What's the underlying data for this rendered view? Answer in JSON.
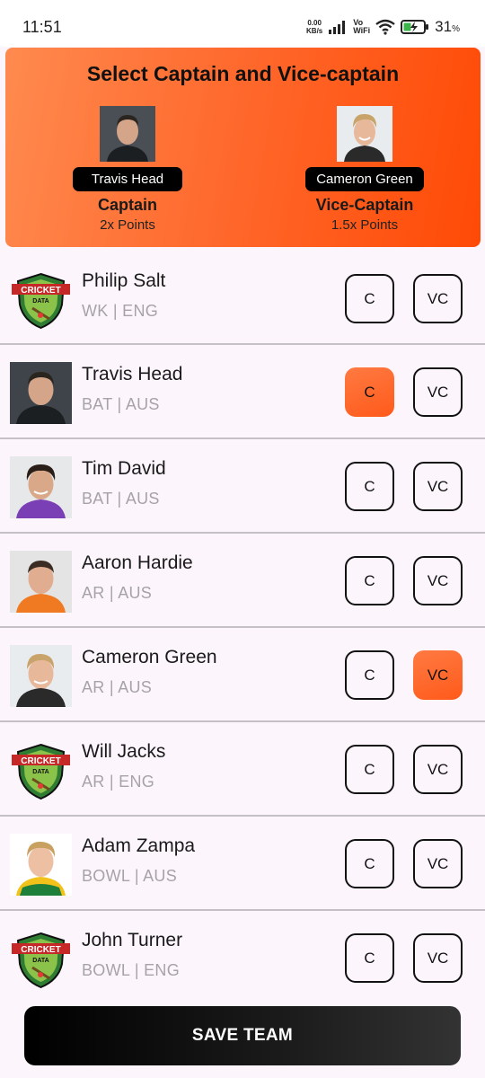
{
  "status_bar": {
    "time": "11:51",
    "speed_value": "0.00",
    "speed_unit": "KB/s",
    "volte_top": "Vo",
    "volte_bottom": "WiFi",
    "battery_percent": "31",
    "battery_unit": "%",
    "icons": [
      "signal-bars-icon",
      "wifi-icon",
      "battery-charging-icon"
    ]
  },
  "header": {
    "title": "Select Captain and Vice-captain",
    "captain": {
      "name": "Travis Head",
      "role": "Captain",
      "points": "2x Points"
    },
    "vice_captain": {
      "name": "Cameron Green",
      "role": "Vice-Captain",
      "points": "1.5x Points"
    },
    "colors": {
      "gradient_start": "#ff8a4f",
      "gradient_end": "#ff4a06"
    }
  },
  "players": [
    {
      "name": "Philip Salt",
      "meta": "WK | ENG",
      "avatar": "cricket-data-logo",
      "c_label": "C",
      "vc_label": "VC",
      "selected": ""
    },
    {
      "name": "Travis Head",
      "meta": "BAT | AUS",
      "avatar": "photo",
      "c_label": "C",
      "vc_label": "VC",
      "selected": "C"
    },
    {
      "name": "Tim David",
      "meta": "BAT | AUS",
      "avatar": "photo",
      "c_label": "C",
      "vc_label": "VC",
      "selected": ""
    },
    {
      "name": "Aaron Hardie",
      "meta": "AR | AUS",
      "avatar": "photo",
      "c_label": "C",
      "vc_label": "VC",
      "selected": ""
    },
    {
      "name": "Cameron Green",
      "meta": "AR | AUS",
      "avatar": "photo",
      "c_label": "C",
      "vc_label": "VC",
      "selected": "VC"
    },
    {
      "name": "Will Jacks",
      "meta": "AR | ENG",
      "avatar": "cricket-data-logo",
      "c_label": "C",
      "vc_label": "VC",
      "selected": ""
    },
    {
      "name": "Adam Zampa",
      "meta": "BOWL | AUS",
      "avatar": "photo",
      "c_label": "C",
      "vc_label": "VC",
      "selected": ""
    },
    {
      "name": "John Turner",
      "meta": "BOWL | ENG",
      "avatar": "cricket-data-logo",
      "c_label": "C",
      "vc_label": "VC",
      "selected": ""
    }
  ],
  "logo_text": {
    "top": "CRICKET",
    "bottom": "DATA"
  },
  "save_label": "SAVE TEAM",
  "accent_color": "#ff5a1a"
}
